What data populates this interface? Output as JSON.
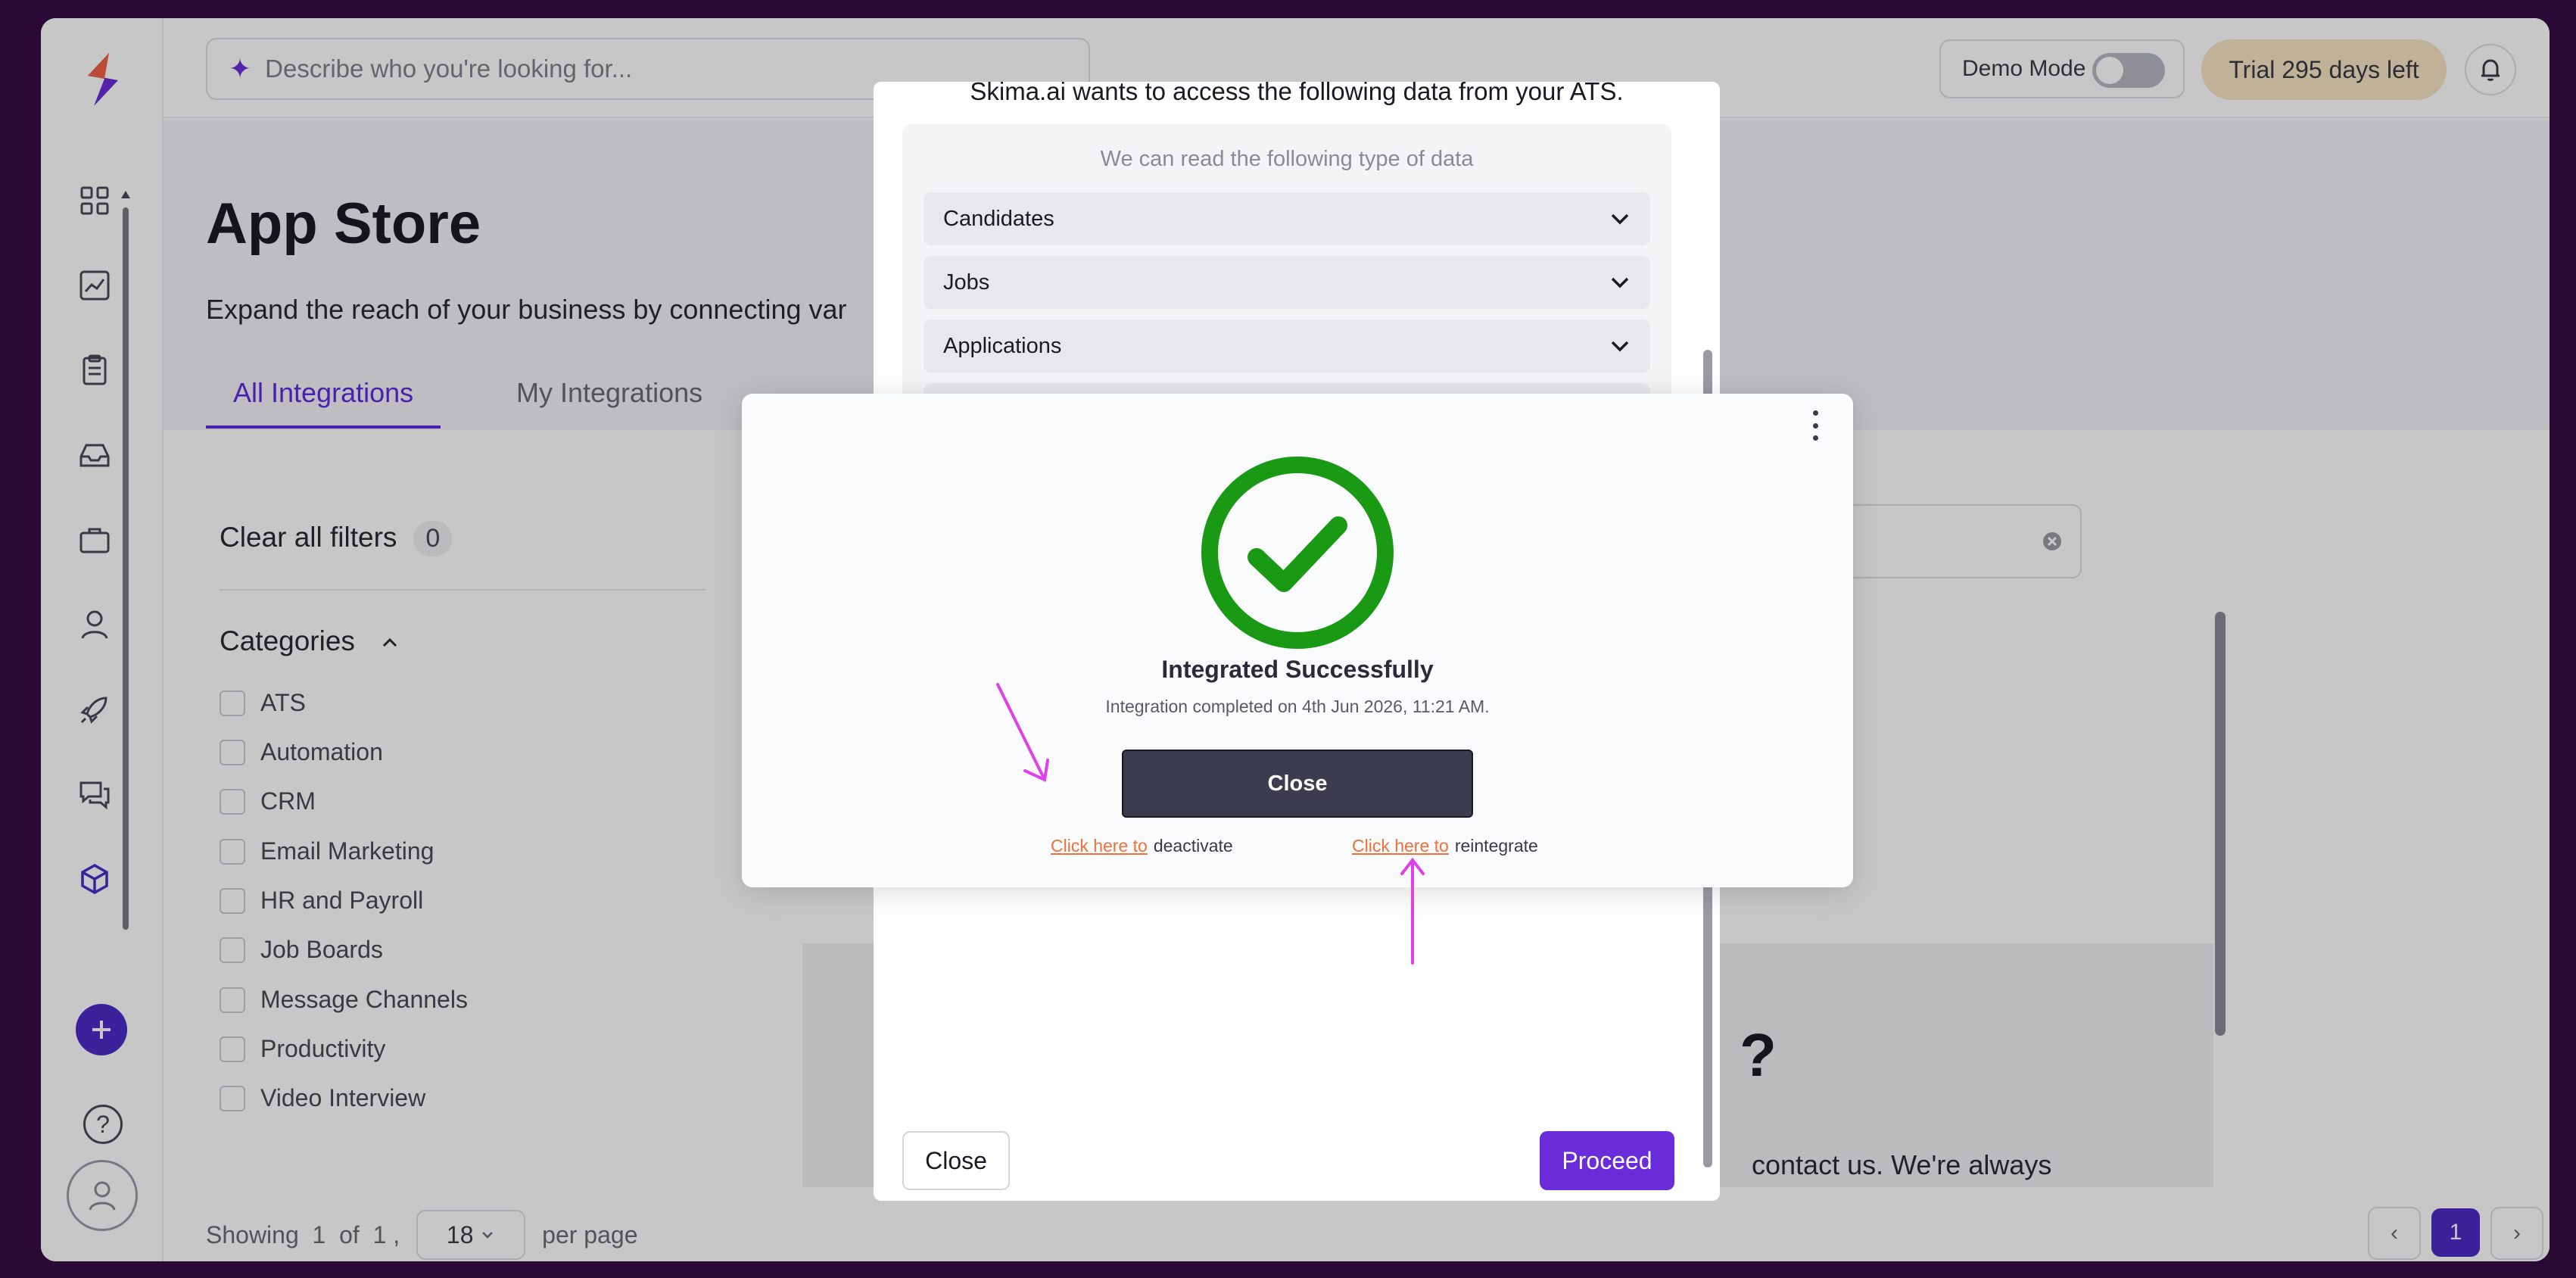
{
  "search": {
    "placeholder": "Describe who you're looking for..."
  },
  "header": {
    "demo_mode_label": "Demo Mode",
    "trial_label": "Trial 295 days left"
  },
  "page": {
    "title": "App Store",
    "subtitle": "Expand the reach of your business by connecting var",
    "tabs": [
      {
        "label": "All Integrations"
      },
      {
        "label": "My Integrations"
      }
    ]
  },
  "filters": {
    "clear_label": "Clear all filters",
    "count": "0",
    "categories_label": "Categories",
    "categories": [
      "ATS",
      "Automation",
      "CRM",
      "Email Marketing",
      "HR and Payroll",
      "Job Boards",
      "Message Channels",
      "Productivity",
      "Video Interview"
    ]
  },
  "pagination": {
    "showing": "Showing",
    "current": "1",
    "of": "of",
    "total": "1",
    "sep": ",",
    "per_page_value": "18",
    "per_page_label": "per page",
    "page": "1"
  },
  "background_panel": {
    "question_mark": "?",
    "contact_text": "contact us. We're always"
  },
  "ats_modal": {
    "title": "Skima.ai wants to access the following data from your ATS.",
    "read_label": "We can read the following type of data",
    "items": [
      "Candidates",
      "Jobs",
      "Applications"
    ],
    "close_label": "Close",
    "proceed_label": "Proceed"
  },
  "success_modal": {
    "title": "Integrated Successfully",
    "subtitle": "Integration completed on  4th Jun 2026, 11:21 AM.",
    "close_label": "Close",
    "deactivate_link": "Click here to",
    "deactivate_text": "deactivate",
    "reintegrate_link": "Click here to",
    "reintegrate_text": "reintegrate"
  },
  "colors": {
    "accent": "#6a2cd8",
    "success": "#1a9a14",
    "link": "#f0703a",
    "annotation": "#e040e8"
  },
  "icons": [
    "logo-icon",
    "grid-icon",
    "chart-icon",
    "clipboard-icon",
    "inbox-icon",
    "briefcase-icon",
    "user-icon",
    "rocket-icon",
    "chat-icon",
    "cube-icon",
    "plus-icon",
    "help-icon",
    "avatar-icon",
    "bell-icon",
    "sparkle-icon",
    "chevron-down-icon",
    "check-circle-icon",
    "kebab-icon"
  ]
}
